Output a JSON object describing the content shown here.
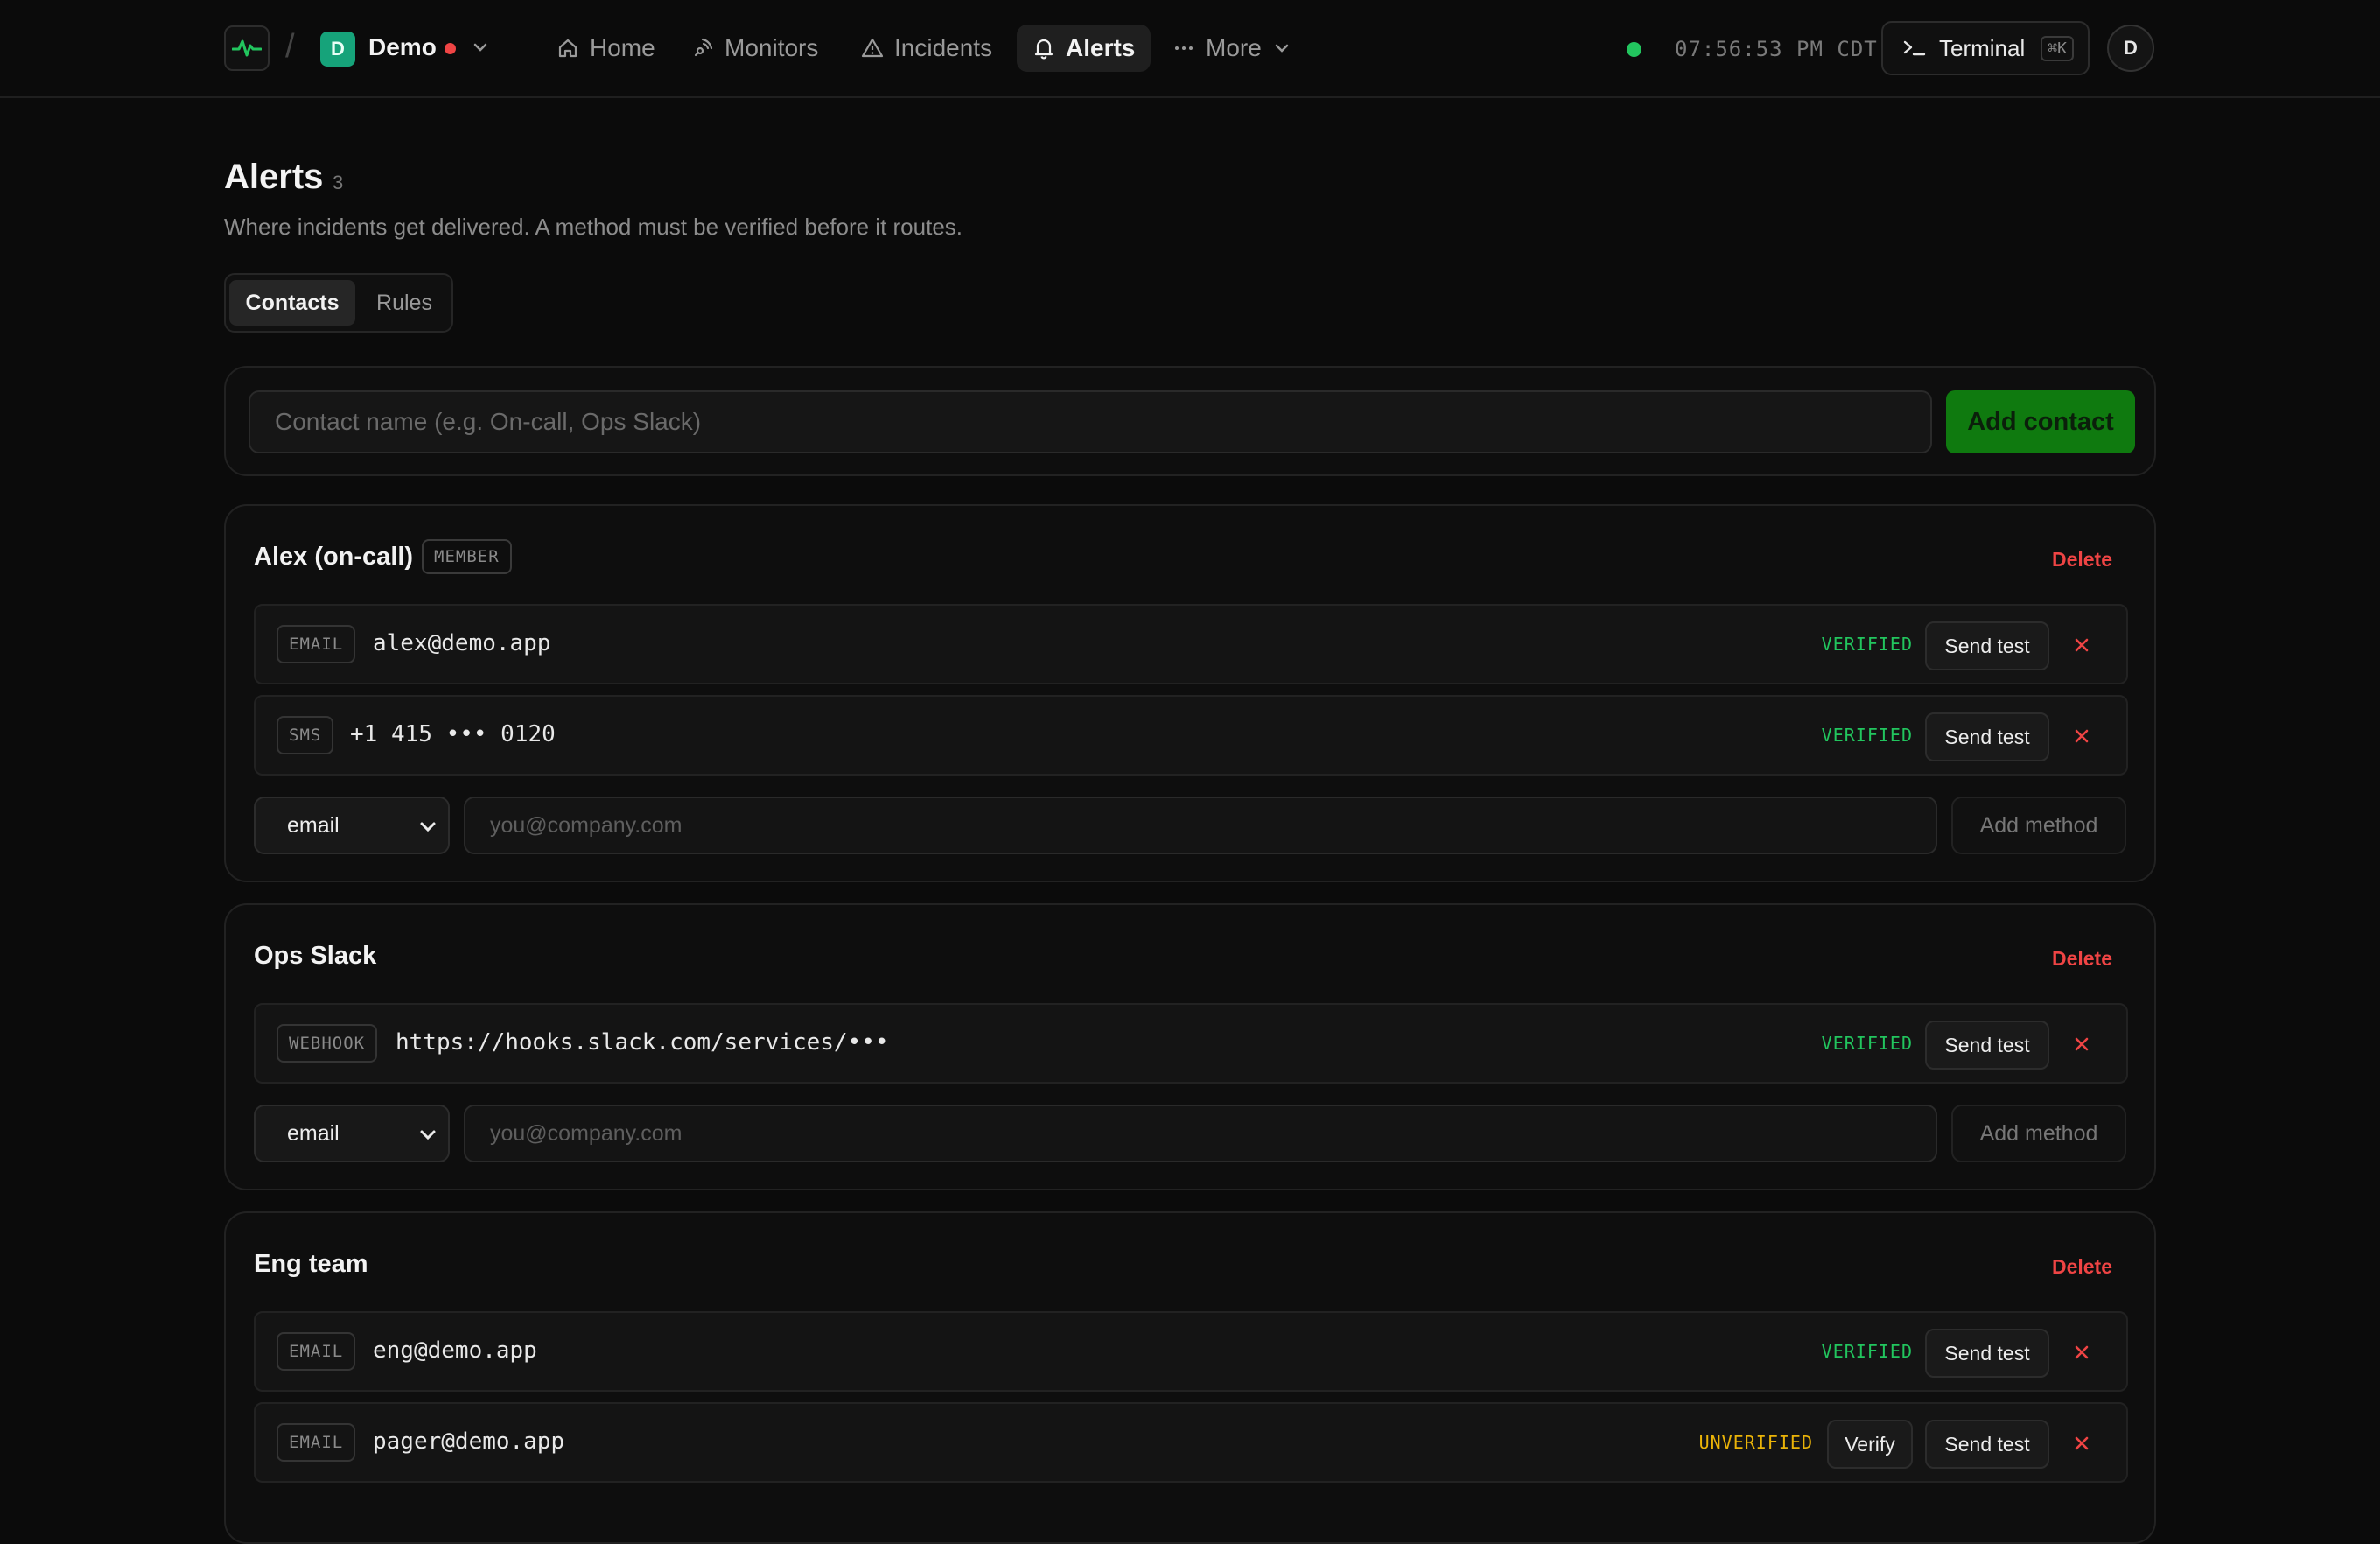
{
  "topbar": {
    "workspace_initial": "D",
    "workspace_name": "Demo",
    "nav": [
      {
        "label": "Home",
        "icon": "home-icon"
      },
      {
        "label": "Monitors",
        "icon": "monitor-signal-icon"
      },
      {
        "label": "Incidents",
        "icon": "warning-triangle-icon"
      },
      {
        "label": "Alerts",
        "icon": "bell-icon",
        "active": true
      },
      {
        "label": "More",
        "icon": "ellipsis-icon"
      }
    ],
    "clock": "07:56:53 PM CDT",
    "terminal_label": "Terminal",
    "terminal_shortcut": "⌘K",
    "user_initial": "D"
  },
  "page": {
    "title": "Alerts",
    "count": "3",
    "subtitle": "Where incidents get delivered. A method must be verified before it routes."
  },
  "tabs": [
    {
      "label": "Contacts",
      "active": true
    },
    {
      "label": "Rules",
      "active": false
    }
  ],
  "add_contact": {
    "placeholder": "Contact name (e.g. On-call, Ops Slack)",
    "button_label": "Add contact"
  },
  "contacts": [
    {
      "name": "Alex (on-call)",
      "role": "MEMBER",
      "delete_label": "Delete",
      "methods": [
        {
          "type": "EMAIL",
          "value": "alex@demo.app",
          "status": "VERIFIED",
          "send_test": "Send test"
        },
        {
          "type": "SMS",
          "value": "+1 415 ••• 0120",
          "status": "VERIFIED",
          "send_test": "Send test"
        }
      ],
      "new_method": {
        "type": "email",
        "placeholder": "you@company.com",
        "button_label": "Add method"
      }
    },
    {
      "name": "Ops Slack",
      "delete_label": "Delete",
      "methods": [
        {
          "type": "WEBHOOK",
          "value": "https://hooks.slack.com/services/•••",
          "status": "VERIFIED",
          "send_test": "Send test"
        }
      ],
      "new_method": {
        "type": "email",
        "placeholder": "you@company.com",
        "button_label": "Add method"
      }
    },
    {
      "name": "Eng team",
      "delete_label": "Delete",
      "methods": [
        {
          "type": "EMAIL",
          "value": "eng@demo.app",
          "status": "VERIFIED",
          "send_test": "Send test"
        },
        {
          "type": "EMAIL",
          "value": "pager@demo.app",
          "status": "UNVERIFIED",
          "verify": "Verify",
          "send_test": "Send test"
        }
      ]
    }
  ],
  "colors": {
    "accent_green": "#22c55e",
    "danger_red": "#ef4444",
    "warning_yellow": "#eab308",
    "button_green": "#0f7a0f",
    "workspace_teal": "#16a37a"
  }
}
